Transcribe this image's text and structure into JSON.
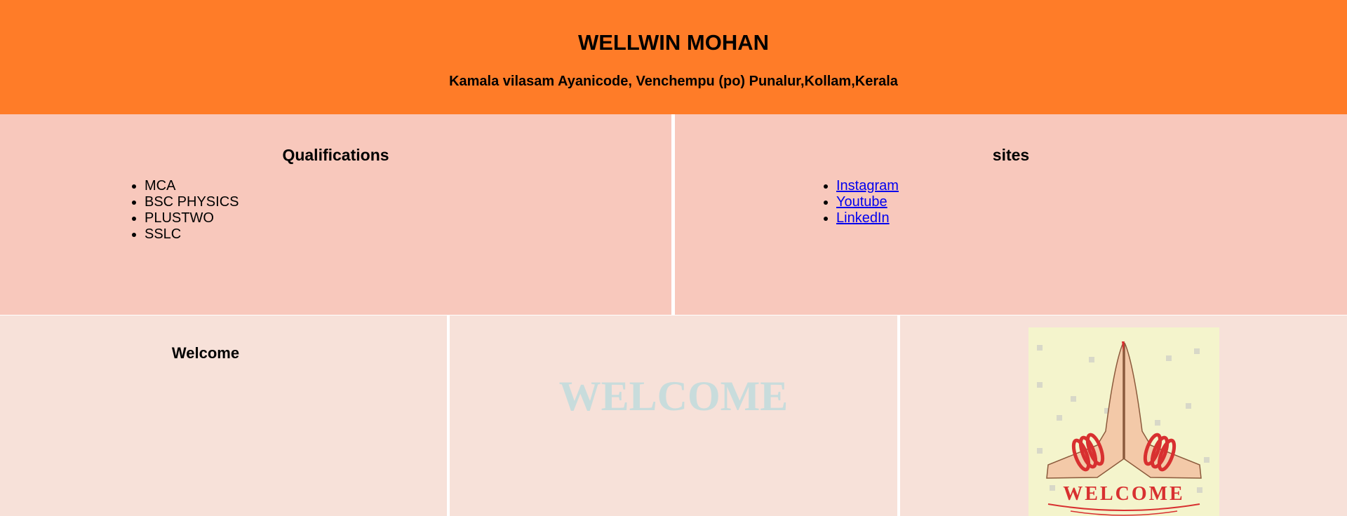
{
  "header": {
    "name": "WELLWIN MOHAN",
    "address": "Kamala vilasam Ayanicode, Venchempu (po) Punalur,Kollam,Kerala"
  },
  "qualifications": {
    "title": "Qualifications",
    "items": [
      "MCA",
      "BSC PHYSICS",
      "PLUSTWO",
      "SSLC"
    ]
  },
  "sites": {
    "title": "sites",
    "links": [
      "Instagram",
      "Youtube",
      "LinkedIn"
    ]
  },
  "welcome_section": {
    "title": "Welcome",
    "banner_text": "WELCOME",
    "image_text": "WELCOME"
  },
  "colors": {
    "header_bg": "#ff7c28",
    "row1_bg": "#f8c8bc",
    "row2_bg": "#f7e1d9",
    "banner_text": "#c8dcdc",
    "link": "#0000ee"
  }
}
